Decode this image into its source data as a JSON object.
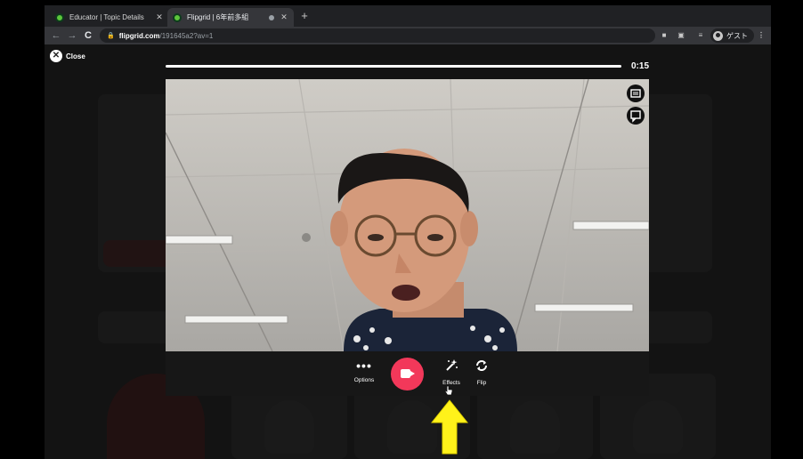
{
  "browser": {
    "tabs": [
      {
        "title": "Educator | Topic Details",
        "active": false
      },
      {
        "title": "Flipgrid | 6年前多組",
        "active": true
      }
    ],
    "url_host": "flipgrid.com",
    "url_path": "/191645a2?av=1",
    "profile_label": "ゲスト"
  },
  "overlay": {
    "close_label": "Close",
    "timer": "0:15",
    "controls": {
      "options_label": "Options",
      "effects_label": "Effects",
      "flip_label": "Flip"
    }
  },
  "colors": {
    "record_button": "#f2385a",
    "annotation_arrow": "#fff21a",
    "tab_favicon": "#5cc63b"
  }
}
